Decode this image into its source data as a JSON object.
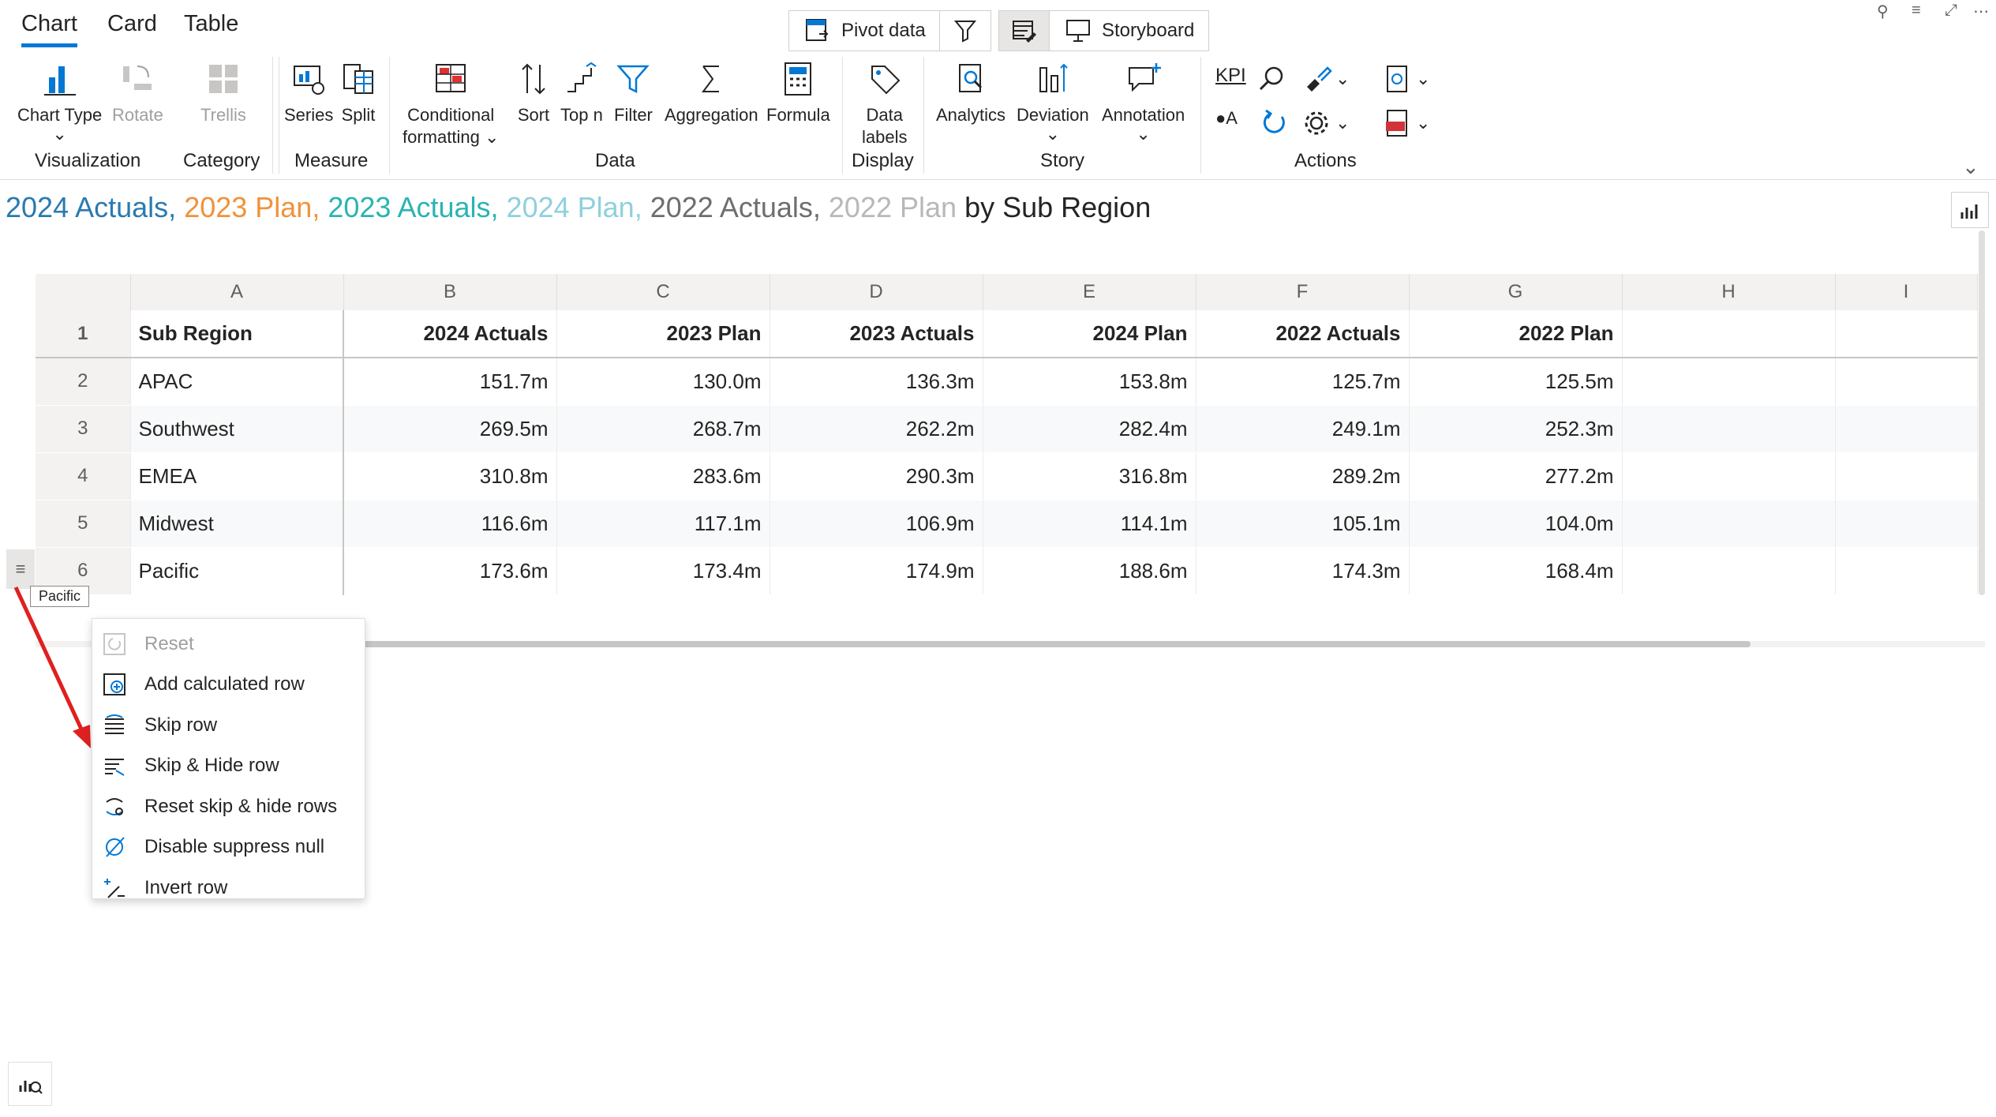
{
  "tabs": [
    "Chart",
    "Card",
    "Table"
  ],
  "top_buttons": {
    "pivot": "Pivot data",
    "storyboard": "Storyboard"
  },
  "ribbon": {
    "chart_type": "Chart Type",
    "rotate": "Rotate",
    "trellis": "Trellis",
    "series": "Series",
    "split": "Split",
    "conditional_formatting_1": "Conditional",
    "conditional_formatting_2": "formatting",
    "sort": "Sort",
    "topn": "Top n",
    "filter": "Filter",
    "aggregation": "Aggregation",
    "formula": "Formula",
    "data_labels_1": "Data",
    "data_labels_2": "labels",
    "analytics": "Analytics",
    "deviation": "Deviation",
    "annotation": "Annotation",
    "kpi": "KPI",
    "groups": {
      "visualization": "Visualization",
      "category": "Category",
      "measure": "Measure",
      "data": "Data",
      "display": "Display",
      "story": "Story",
      "actions": "Actions"
    }
  },
  "title": {
    "parts": [
      {
        "text": "2024 Actuals,",
        "color": "#2a7ab0"
      },
      {
        "text": "2023 Plan,",
        "color": "#f0923a"
      },
      {
        "text": "2023 Actuals,",
        "color": "#2bb3b3"
      },
      {
        "text": "2024 Plan,",
        "color": "#8fd0dc"
      },
      {
        "text": "2022 Actuals,",
        "color": "#6e6e6e"
      },
      {
        "text": "2022 Plan",
        "color": "#b8b8b8"
      }
    ],
    "suffix": "by Sub Region"
  },
  "grid": {
    "columns": [
      "A",
      "B",
      "C",
      "D",
      "E",
      "F",
      "G",
      "H",
      "I"
    ],
    "headers": [
      "Sub Region",
      "2024 Actuals",
      "2023 Plan",
      "2023 Actuals",
      "2024 Plan",
      "2022 Actuals",
      "2022 Plan"
    ],
    "rows": [
      {
        "n": "2",
        "cells": [
          "APAC",
          "151.7m",
          "130.0m",
          "136.3m",
          "153.8m",
          "125.7m",
          "125.5m"
        ]
      },
      {
        "n": "3",
        "cells": [
          "Southwest",
          "269.5m",
          "268.7m",
          "262.2m",
          "282.4m",
          "249.1m",
          "252.3m"
        ]
      },
      {
        "n": "4",
        "cells": [
          "EMEA",
          "310.8m",
          "283.6m",
          "290.3m",
          "316.8m",
          "289.2m",
          "277.2m"
        ]
      },
      {
        "n": "5",
        "cells": [
          "Midwest",
          "116.6m",
          "117.1m",
          "106.9m",
          "114.1m",
          "105.1m",
          "104.0m"
        ]
      },
      {
        "n": "6",
        "cells": [
          "Pacific",
          "173.6m",
          "173.4m",
          "174.9m",
          "188.6m",
          "174.3m",
          "168.4m"
        ]
      }
    ]
  },
  "tooltip": "Pacific",
  "context_menu": [
    {
      "label": "Reset",
      "icon": "reset-icon",
      "disabled": true
    },
    {
      "label": "Add calculated row",
      "icon": "add-calc-row-icon"
    },
    {
      "label": "Skip row",
      "icon": "skip-row-icon"
    },
    {
      "label": "Skip & Hide row",
      "icon": "skip-hide-row-icon"
    },
    {
      "label": "Reset skip & hide rows",
      "icon": "reset-skip-icon"
    },
    {
      "label": "Disable suppress null",
      "icon": "suppress-null-icon"
    },
    {
      "label": "Invert row",
      "icon": "invert-row-icon"
    }
  ],
  "colors": {
    "accent": "#0078d4",
    "arrow": "#e02020"
  }
}
